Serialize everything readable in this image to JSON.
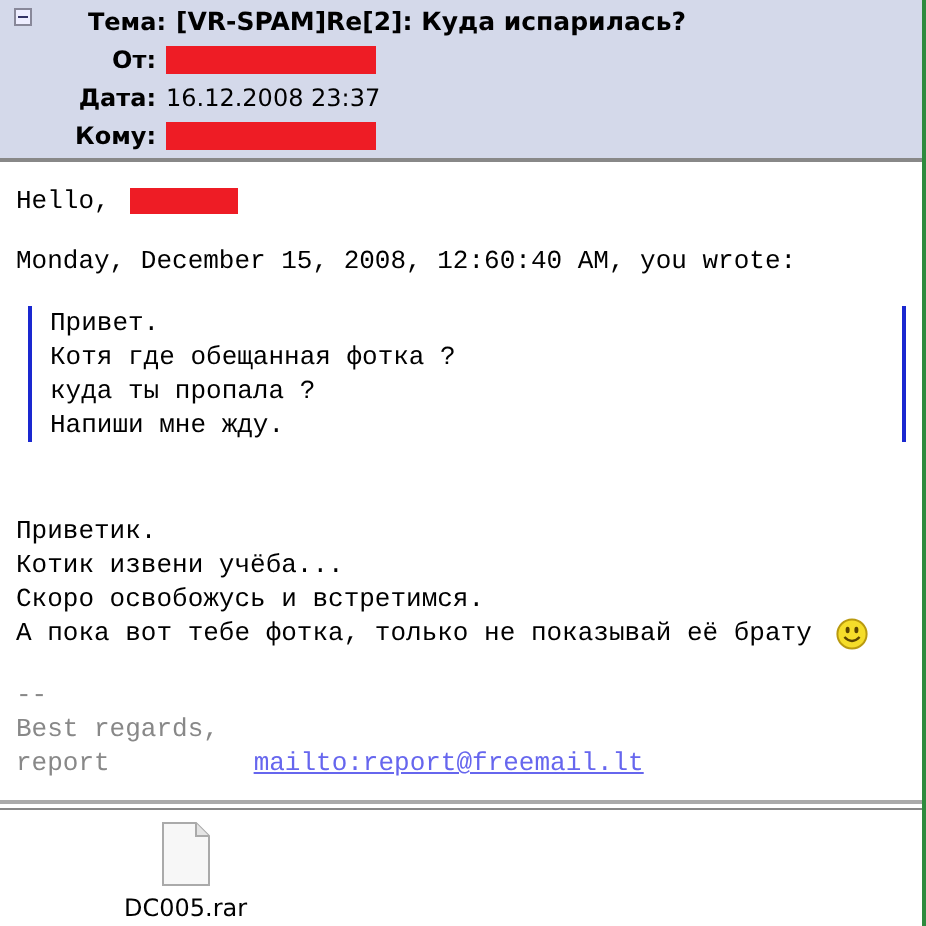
{
  "header": {
    "expanded": true,
    "fields": [
      {
        "label": "Тема:",
        "value": "[VR-SPAM]Re[2]: Куда испарилась?",
        "kind": "subject"
      },
      {
        "label": "От:",
        "redacted": true,
        "kind": "plain"
      },
      {
        "label": "Дата:",
        "value": "16.12.2008 23:37",
        "kind": "plain"
      },
      {
        "label": "Кому:",
        "redacted": true,
        "kind": "plain"
      }
    ]
  },
  "body": {
    "greeting": "Hello,",
    "greeting_redacted": true,
    "attribution": "Monday, December 15, 2008, 12:60:40 AM, you wrote:",
    "quote": [
      "Привет.",
      "Котя где обещанная фотка ?",
      "куда ты пропала ?",
      "Напиши мне жду."
    ],
    "reply": [
      "Приветик.",
      "Котик извени учёба...",
      "Скоро освобожусь и встретимся.",
      "А пока вот тебе фотка, только не показывай её брату"
    ],
    "signature": {
      "dashes": "--",
      "lines": [
        "Best regards,",
        "report"
      ],
      "link": "mailto:report@freemail.lt"
    }
  },
  "attachments": [
    {
      "name": "DC005.rar"
    }
  ]
}
